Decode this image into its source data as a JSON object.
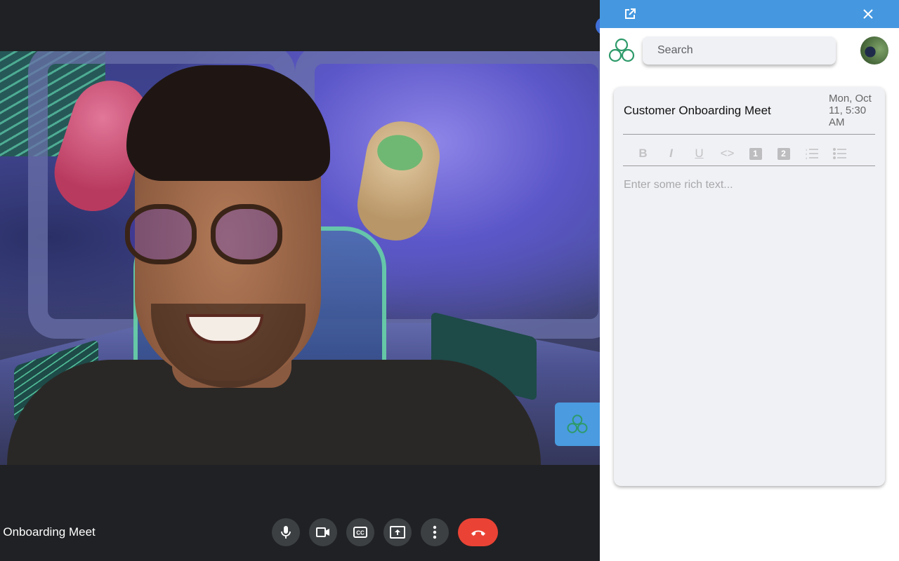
{
  "meet": {
    "meeting_name": "r Onboarding Meet",
    "controls": [
      {
        "name": "microphone",
        "icon": "mic-icon"
      },
      {
        "name": "camera",
        "icon": "video-camera-icon"
      },
      {
        "name": "captions",
        "icon": "closed-captions-icon"
      },
      {
        "name": "present",
        "icon": "present-screen-icon"
      },
      {
        "name": "more-options",
        "icon": "more-vertical-icon"
      },
      {
        "name": "leave-call",
        "icon": "hang-up-icon"
      }
    ],
    "colors": {
      "background": "#202124",
      "control": "#3c4043",
      "end_call": "#ea4335",
      "fab": "#4a9be0"
    }
  },
  "sidebar": {
    "header_icons": [
      "open-external-icon",
      "close-icon"
    ],
    "search": {
      "placeholder": "Search"
    },
    "note": {
      "title": "Customer Onboarding Meet",
      "date": "Mon, Oct 11, 5:30 AM",
      "toolbar": [
        {
          "name": "bold",
          "label": "B"
        },
        {
          "name": "italic",
          "label": "I"
        },
        {
          "name": "underline",
          "label": "U"
        },
        {
          "name": "code",
          "label": "<>"
        },
        {
          "name": "heading-1",
          "label": "1"
        },
        {
          "name": "heading-2",
          "label": "2"
        },
        {
          "name": "ordered-list",
          "label": ""
        },
        {
          "name": "bullet-list",
          "label": ""
        }
      ],
      "editor_placeholder": "Enter some rich text..."
    },
    "colors": {
      "header": "#4598e0",
      "logo": "#2e9a6a",
      "card": "#f0f1f5"
    }
  }
}
